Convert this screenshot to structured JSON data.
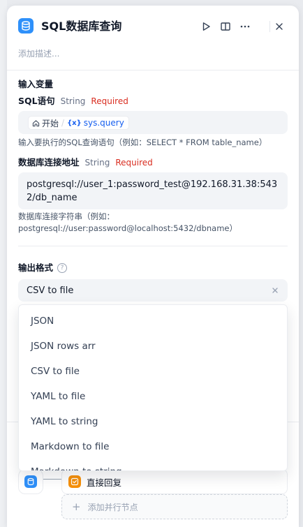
{
  "header": {
    "title": "SQL数据库查询",
    "description_placeholder": "添加描述..."
  },
  "input_section": {
    "title": "输入变量",
    "sql": {
      "label": "SQL语句",
      "type": "String",
      "required": "Required",
      "node_name": "开始",
      "separator": "/",
      "var_brace": "{x}",
      "var_name": "sys.query",
      "hint": "输入要执行的SQL查询语句（例如：SELECT * FROM table_name）"
    },
    "conn": {
      "label": "数据库连接地址",
      "type": "String",
      "required": "Required",
      "value": "postgresql://user_1:password_test@192.168.31.38:5432/db_name",
      "hint": "数据库连接字符串（例如：postgresql://user:password@localhost:5432/dbname）"
    }
  },
  "output_format": {
    "label": "输出格式",
    "help": "?",
    "selected": "CSV to file",
    "options": [
      "JSON",
      "JSON rows arr",
      "CSV to file",
      "YAML to file",
      "YAML to string",
      "Markdown to file",
      "Markdown to string"
    ]
  },
  "next_step": {
    "node_label": "直接回复",
    "add_parallel": "添加并行节点",
    "plus": "+"
  },
  "colors": {
    "accent": "#2e90fa",
    "required": "#d92d20",
    "variable": "#155eef",
    "reply": "#f79009"
  }
}
